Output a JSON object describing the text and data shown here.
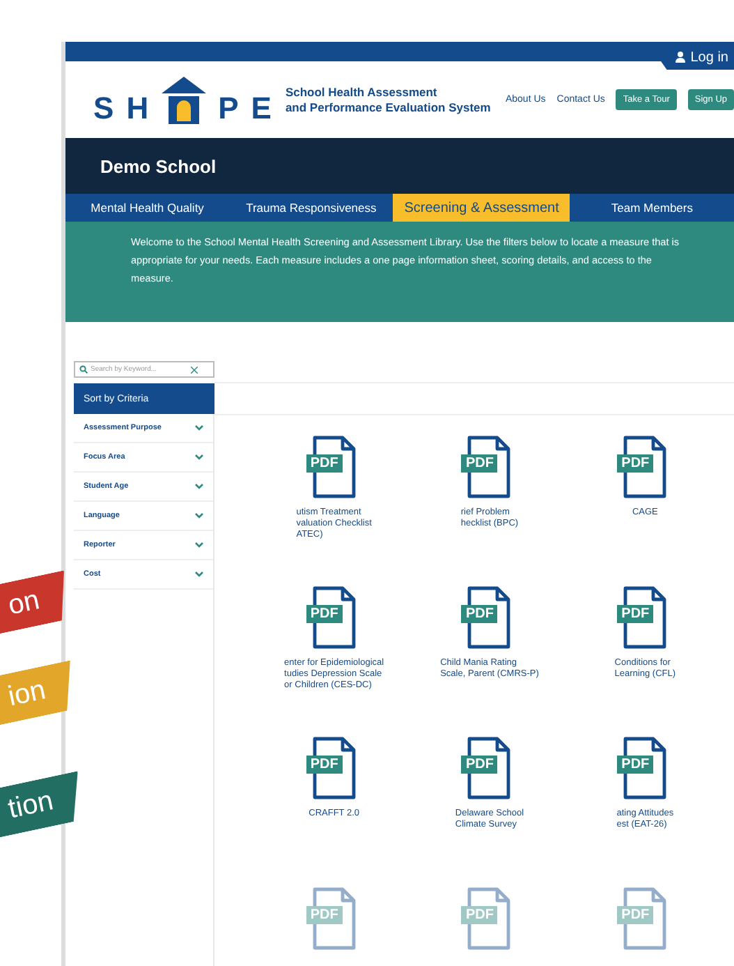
{
  "top_bar": {
    "login": "Log in"
  },
  "header": {
    "logo_letters": [
      "S",
      "H",
      "P",
      "E"
    ],
    "tagline": [
      "School Health Assessment",
      "and Performance Evaluation System"
    ],
    "links": [
      "About Us",
      "Contact Us"
    ],
    "buttons": [
      "Take a Tour",
      "Sign Up"
    ]
  },
  "school": {
    "name": "Demo School"
  },
  "tabs": [
    {
      "label": "Mental Health Quality",
      "selected": false
    },
    {
      "label": "Trauma Responsiveness",
      "selected": false
    },
    {
      "label": "Screening & Assessment",
      "selected": true
    },
    {
      "label": "Team Members",
      "selected": false
    }
  ],
  "intro": "Welcome to the School Mental Health Screening and Assessment Library. Use the filters below to locate a measure that is appropriate for your needs. Each measure includes a one page information sheet, scoring details, and access to the measure.",
  "search": {
    "placeholder": "Search by Keyword..."
  },
  "sidebar": {
    "title": "Sort by Criteria",
    "filters": [
      {
        "label": "Assessment Purpose",
        "expanded": false
      },
      {
        "label": "Focus Area",
        "expanded": false
      },
      {
        "label": "Student Age",
        "expanded": false
      },
      {
        "label": "Language",
        "expanded": false
      },
      {
        "label": "Reporter",
        "expanded": false
      },
      {
        "label": "Cost",
        "expanded": false
      }
    ]
  },
  "measures": [
    {
      "badge": "PDF",
      "title": "utism Treatment\nvaluation Checklist\nATEC)",
      "faded": false
    },
    {
      "badge": "PDF",
      "title": "rief Problem\nhecklist (BPC)",
      "faded": false
    },
    {
      "badge": "PDF",
      "title": "CAGE",
      "faded": false
    },
    {
      "badge": "PDF",
      "title": "enter for Epidemiological\ntudies Depression Scale\nor Children (CES-DC)",
      "faded": false
    },
    {
      "badge": "PDF",
      "title": "Child Mania Rating\nScale, Parent (CMRS-P)",
      "faded": false
    },
    {
      "badge": "PDF",
      "title": "Conditions for\nLearning (CFL)",
      "faded": false
    },
    {
      "badge": "PDF",
      "title": "CRAFFT 2.0",
      "faded": false
    },
    {
      "badge": "PDF",
      "title": "Delaware School\nClimate Survey",
      "faded": false
    },
    {
      "badge": "PDF",
      "title": "ating Attitudes\nest (EAT-26)",
      "faded": false
    },
    {
      "badge": "PDF",
      "faded": true
    },
    {
      "badge": "PDF",
      "faded": true
    },
    {
      "badge": "PDF",
      "faded": true
    }
  ],
  "ribbons": [
    {
      "text": "on",
      "color": "#c8362c"
    },
    {
      "text": "ion",
      "color": "#e2a72a"
    },
    {
      "text": "tion",
      "color": "#236e63"
    }
  ]
}
